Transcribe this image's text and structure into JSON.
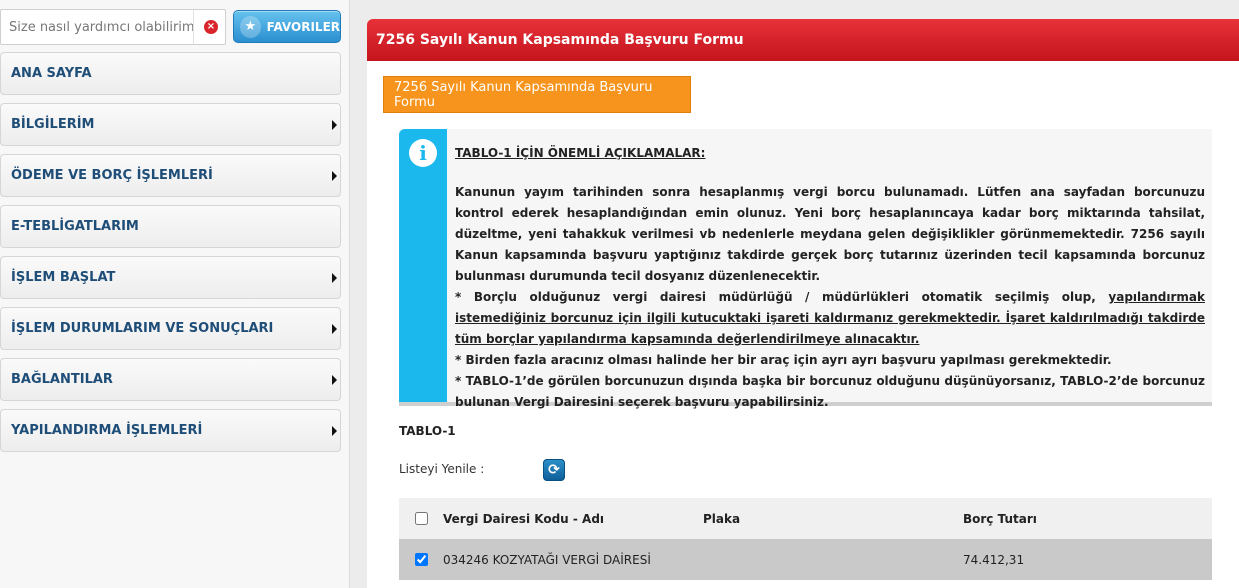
{
  "search": {
    "placeholder": "Size nasıl yardımcı olabilirim?"
  },
  "favorites": {
    "label": "FAVORILER",
    "icon": "star-icon"
  },
  "menu": {
    "items": [
      {
        "label": "ANA SAYFA",
        "has_arrow": false
      },
      {
        "label": "BİLGİLERİM",
        "has_arrow": true
      },
      {
        "label": "ÖDEME VE BORÇ İŞLEMLERİ",
        "has_arrow": true
      },
      {
        "label": "E-TEBLİGATLARIM",
        "has_arrow": false
      },
      {
        "label": "İŞLEM BAŞLAT",
        "has_arrow": true
      },
      {
        "label": "İŞLEM DURUMLARIM VE SONUÇLARI",
        "has_arrow": true
      },
      {
        "label": "BAĞLANTILAR",
        "has_arrow": true
      },
      {
        "label": "YAPILANDIRMA İŞLEMLERİ",
        "has_arrow": true
      }
    ]
  },
  "main": {
    "header_title": "7256 Sayılı Kanun Kapsamında Başvuru Formu",
    "tab_label": "7256 Sayılı Kanun Kapsamında Başvuru Formu",
    "info": {
      "title": "TABLO-1 İÇİN ÖNEMLİ AÇIKLAMALAR:",
      "paragraph": "Kanunun yayım tarihinden sonra hesaplanmış vergi borcu bulunamadı. Lütfen ana sayfadan borcunuzu kontrol ederek hesaplandığından emin olunuz. Yeni borç hesaplanıncaya kadar borç miktarında tahsilat, düzeltme, yeni tahakkuk verilmesi vb nedenlerle meydana gelen değişiklikler görünmemektedir. 7256 sayılı Kanun kapsamında başvuru yaptığınız takdirde gerçek borç tutarınız üzerinden tecil kapsamında borcunuz bulunması durumunda tecil dosyanız düzenlenecektir.",
      "bullet1_plain": "* Borçlu olduğunuz vergi dairesi müdürlüğü / müdürlükleri otomatik seçilmiş olup, ",
      "bullet1_underlined": "yapılandırmak istemediğiniz borcunuz için ilgili kutucuktaki işareti kaldırmanız gerekmektedir. İşaret kaldırılmadığı takdirde tüm borçlar yapılandırma kapsamında değerlendirilmeye alınacaktır.",
      "bullet2": "* Birden fazla aracınız olması halinde her bir araç için ayrı ayrı başvuru yapılması gerekmektedir.",
      "bullet3": "* TABLO-1’de görülen borcunuzun dışında başka bir borcunuz olduğunu düşünüyorsanız, TABLO-2’de borcunuz bulunan Vergi Dairesini seçerek başvuru yapabilirsiniz."
    },
    "table_label": "TABLO-1",
    "refresh_label": "Listeyi Yenile :",
    "table": {
      "columns": [
        "Vergi Dairesi Kodu - Adı",
        "Plaka",
        "Borç Tutarı"
      ],
      "rows": [
        {
          "checked": true,
          "vergi_dairesi": "034246 KOZYATAĞI VERGİ DAİRESİ",
          "plaka": "",
          "borc": "74.412,31"
        }
      ]
    }
  },
  "colors": {
    "header_red": "#d8232a",
    "tab_orange": "#f7941d",
    "info_blue": "#1ab8ec",
    "menu_text": "#1e4d78"
  }
}
